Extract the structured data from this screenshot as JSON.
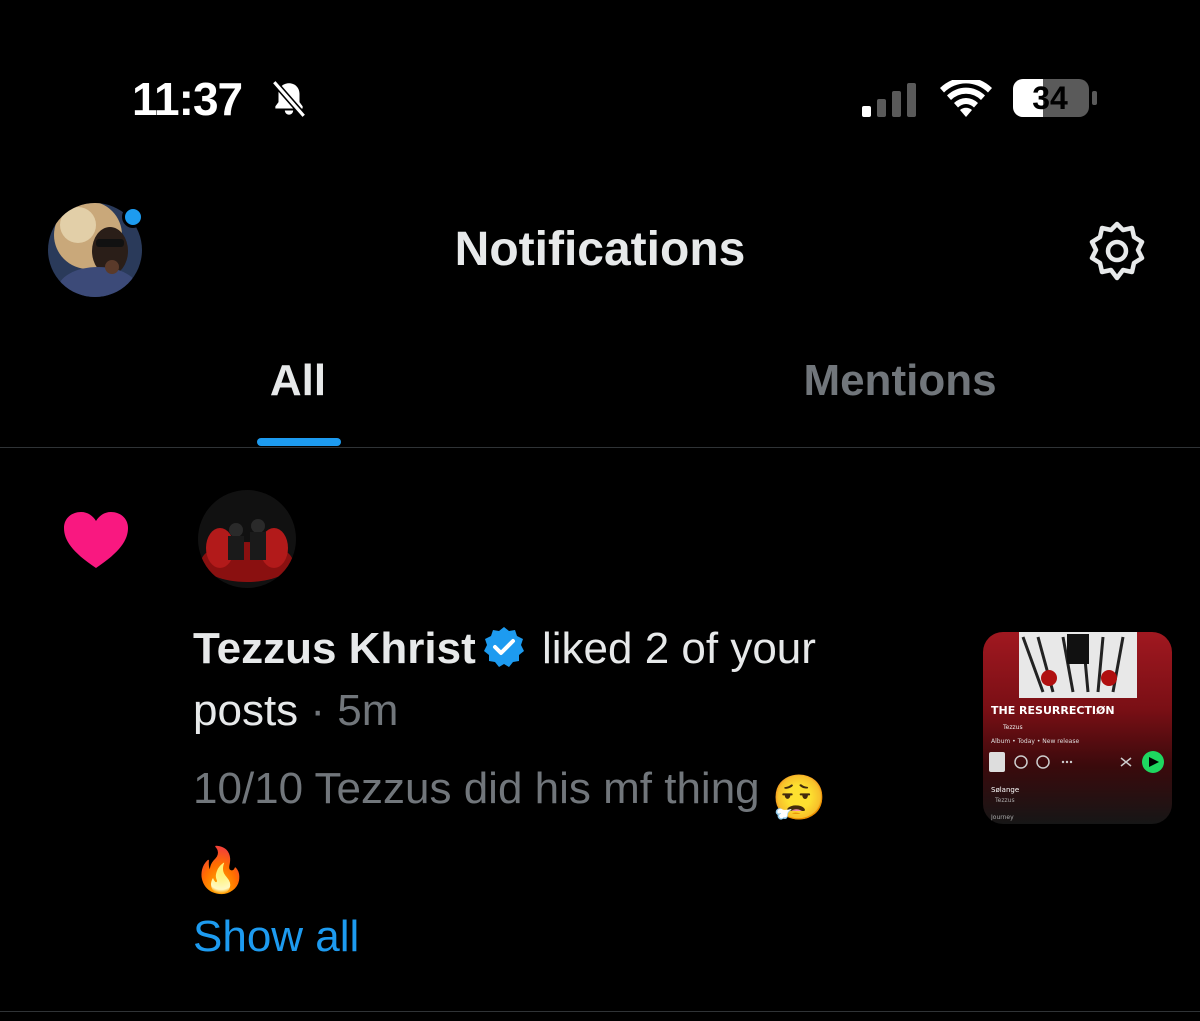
{
  "status_bar": {
    "time": "11:37",
    "battery": "34",
    "icons": [
      "bell-muted-icon",
      "cellular-signal-icon",
      "wifi-icon",
      "battery-icon"
    ]
  },
  "header": {
    "title": "Notifications",
    "settings_icon": "gear-icon"
  },
  "tabs": [
    {
      "label": "All",
      "active": true
    },
    {
      "label": "Mentions",
      "active": false
    }
  ],
  "colors": {
    "accent": "#1d9bf0",
    "like": "#f91880",
    "muted": "#71767b",
    "text": "#e7e9ea"
  },
  "notification": {
    "type_icon": "heart-icon",
    "user_name": "Tezzus Khrist",
    "verified_icon": "verified-badge-icon",
    "action_text": " liked 2 of your posts",
    "separator": " · ",
    "time": "5m",
    "post_text": "10/10 Tezzus did his mf thing ",
    "post_emoji_1": "😮‍💨",
    "post_emoji_2": "🔥",
    "show_all_label": "Show all",
    "thumbnail": {
      "album_title": "THE RESURRECTIØN",
      "artist": "Tezzus",
      "meta": "Album • Today • New release",
      "song": "Sølange",
      "song_artist": "Tezzus",
      "next": "Journey"
    }
  }
}
